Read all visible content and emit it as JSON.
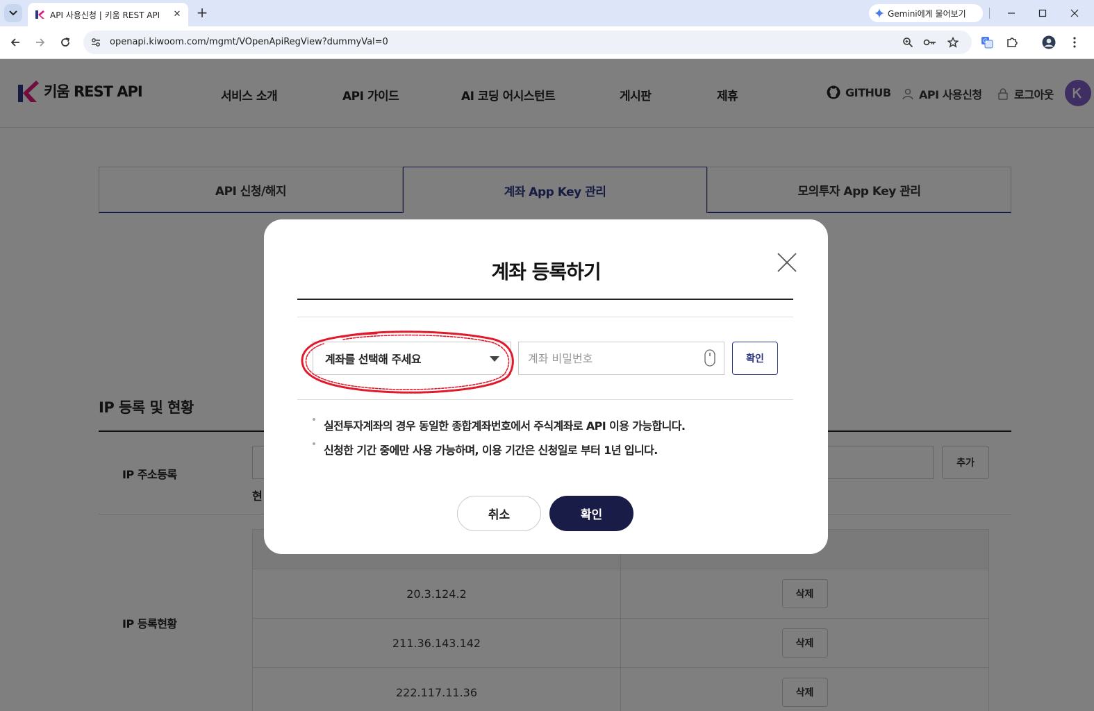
{
  "browser": {
    "tab_title": "API 사용신청 | 키움 REST API",
    "gemini_label": "Gemini에게 물어보기",
    "url": "openapi.kiwoom.com/mgmt/VOpenApiRegView?dummyVal=0"
  },
  "header": {
    "logo_text": "키움 REST API",
    "nav": [
      "서비스 소개",
      "API 가이드",
      "AI 코딩 어시스턴트",
      "게시판",
      "제휴"
    ],
    "github_label": "GITHUB",
    "api_apply_label": "API 사용신청",
    "logout_label": "로그아웃"
  },
  "subtabs": [
    "API 신청/해지",
    "계좌 App Key 관리",
    "모의투자 App Key 관리"
  ],
  "ip_section": {
    "title": "IP 등록 및 현황",
    "register_label": "IP 주소등록",
    "add_label": "추가",
    "current_prefix": "현",
    "status_label": "IP 등록현황",
    "rows": [
      {
        "ip": "20.3.124.2",
        "action": "삭제"
      },
      {
        "ip": "211.36.143.142",
        "action": "삭제"
      },
      {
        "ip": "222.117.11.36",
        "action": "삭제"
      }
    ]
  },
  "modal": {
    "title": "계좌 등록하기",
    "select_placeholder": "계좌를 선택해 주세요",
    "password_placeholder": "계좌 비밀번호",
    "check_label": "확인",
    "notes": [
      "실전투자계좌의 경우 동일한 종합계좌번호에서 주식계좌로 API 이용 가능합니다.",
      "신청한 기간 중에만 사용 가능하며, 이용 기간은 신청일로 부터 1년 입니다."
    ],
    "cancel_label": "취소",
    "confirm_label": "확인"
  },
  "colors": {
    "brand_navy": "#1a1c48",
    "accent_blue": "#2d3682",
    "annotation_red": "#e0192b"
  }
}
